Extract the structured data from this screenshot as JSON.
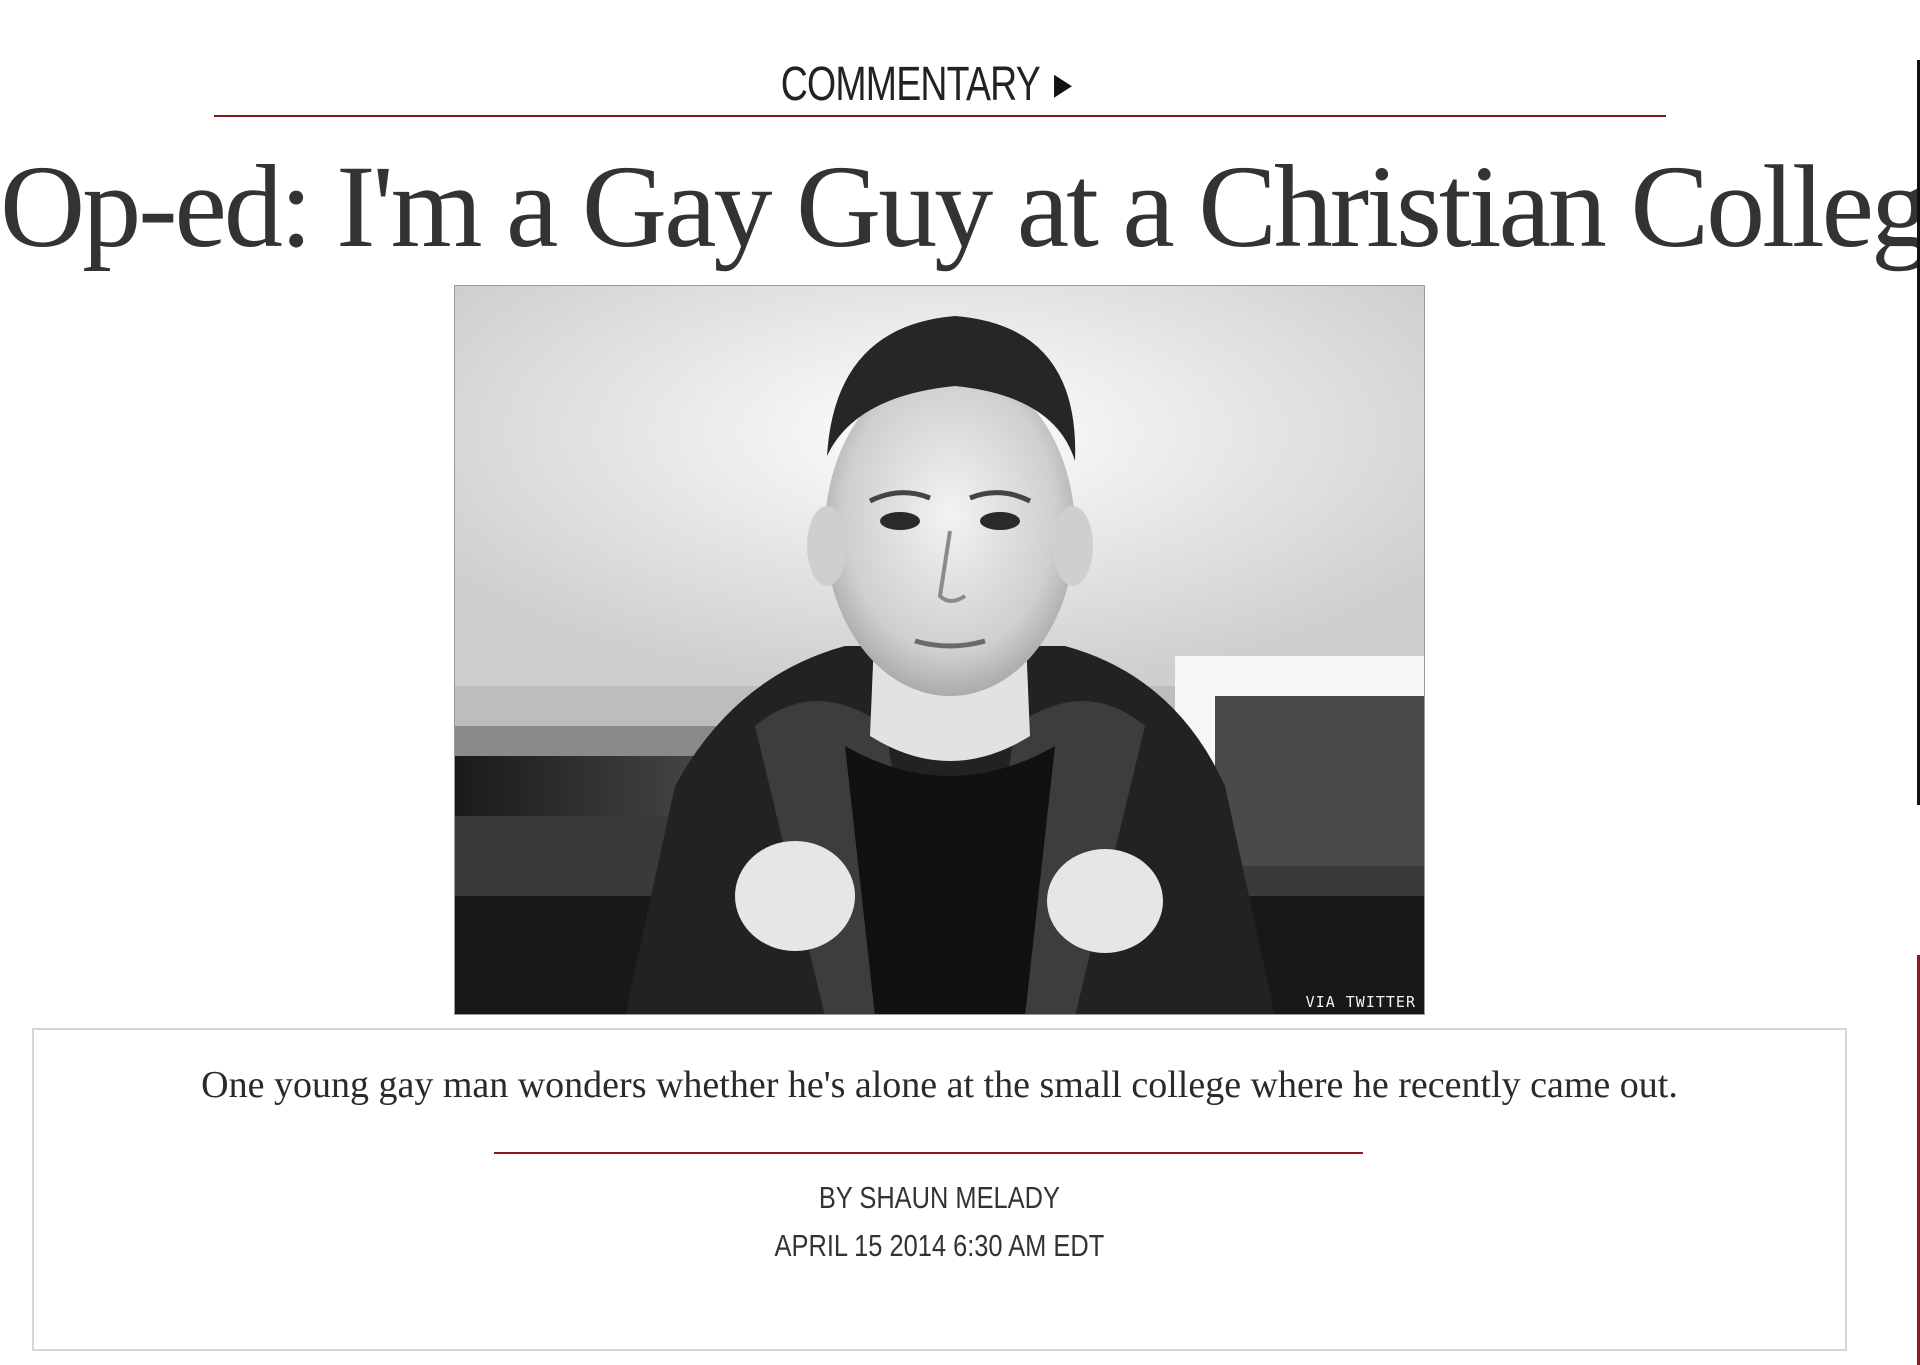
{
  "section": {
    "label": "COMMENTARY",
    "arrow_icon": "right-triangle-icon",
    "accent_color": "#8b1a1a"
  },
  "article": {
    "headline": "Op-ed: I'm a Gay Guy at a Christian College",
    "photo": {
      "description_icon": "portrait-photo",
      "credit": "VIA TWITTER"
    },
    "dek": "One young gay man wonders whether he's alone at the small college where he recently came out.",
    "byline": "BY SHAUN MELADY",
    "dateline": "APRIL 15 2014 6:30 AM EDT"
  }
}
